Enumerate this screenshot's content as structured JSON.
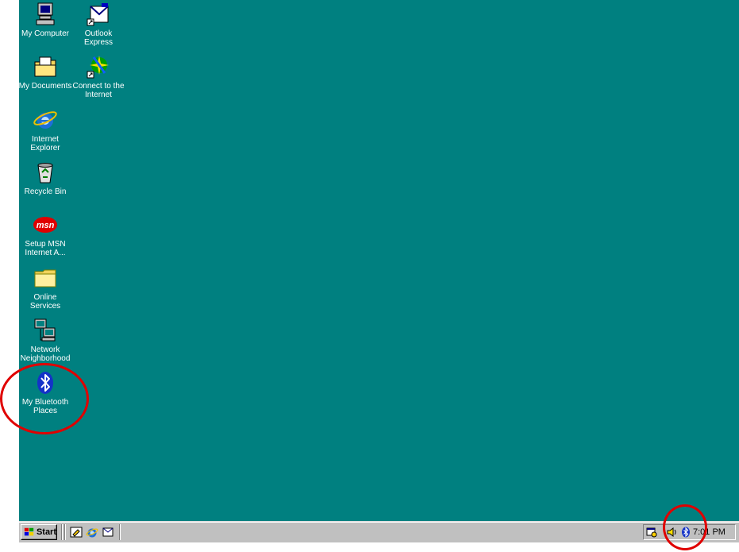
{
  "desktop": {
    "background": "#008080",
    "icons": [
      {
        "label": "My Computer",
        "icon": "computer-icon"
      },
      {
        "label": "Outlook\nExpress",
        "icon": "outlook-express-icon"
      },
      {
        "label": "My Documents",
        "icon": "folder-documents-icon"
      },
      {
        "label": "Connect to the\nInternet",
        "icon": "connect-internet-icon"
      },
      {
        "label": "Internet\nExplorer",
        "icon": "internet-explorer-icon"
      },
      {
        "label": "Recycle Bin",
        "icon": "recycle-bin-icon"
      },
      {
        "label": "Setup MSN\nInternet A...",
        "icon": "msn-icon"
      },
      {
        "label": "Online\nServices",
        "icon": "folder-icon"
      },
      {
        "label": "Network\nNeighborhood",
        "icon": "network-icon"
      },
      {
        "label": "My Bluetooth\nPlaces",
        "icon": "bluetooth-icon"
      }
    ]
  },
  "taskbar": {
    "start_label": "Start",
    "quick_launch": [
      "show-desktop-icon",
      "internet-explorer-icon",
      "outlook-icon"
    ],
    "tray": {
      "icons": [
        "scheduler-icon",
        "volume-icon",
        "bluetooth-icon"
      ],
      "clock": "7:01 PM"
    }
  },
  "annotations": {
    "highlight_color": "#e00000"
  }
}
